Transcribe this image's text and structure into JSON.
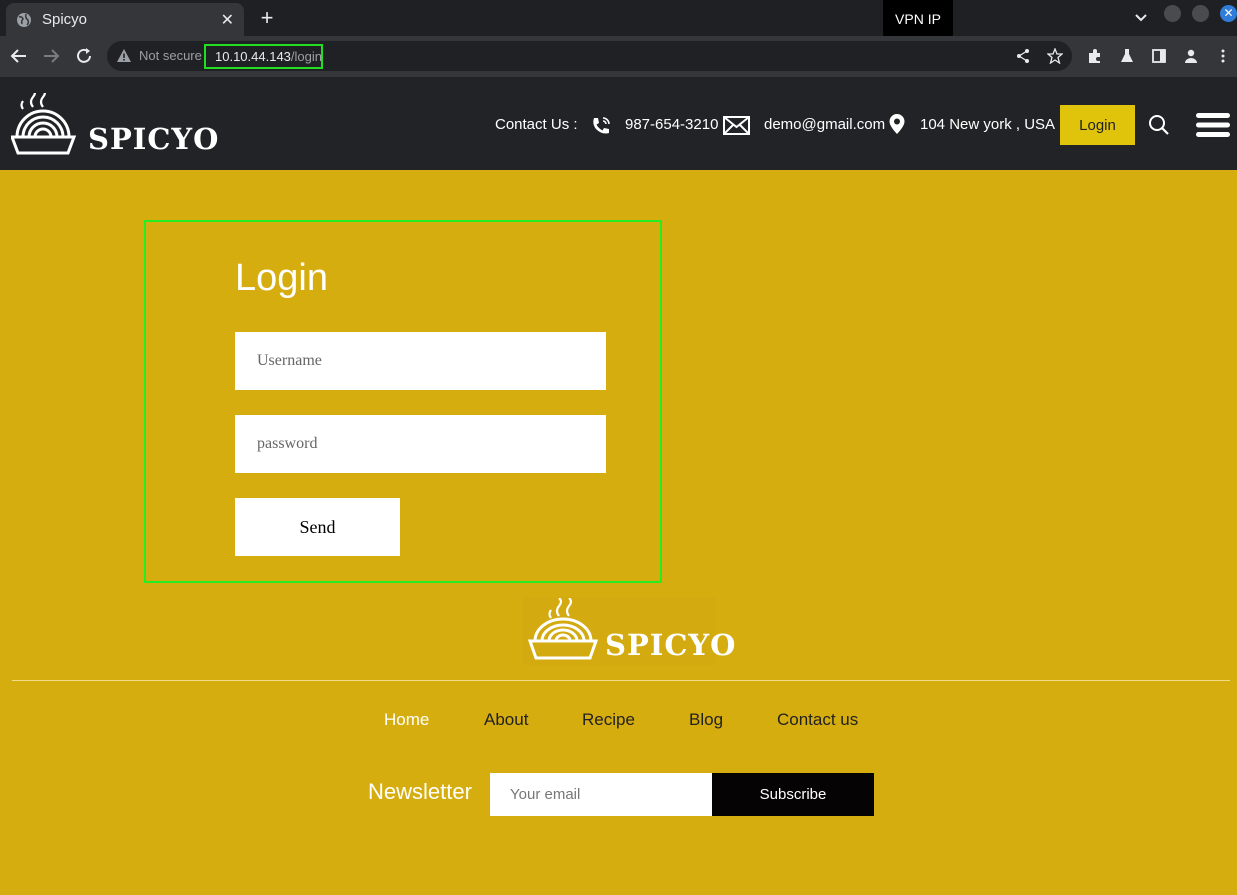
{
  "browser": {
    "tab_title": "Spicyo",
    "tab_close": "✕",
    "new_tab": "+",
    "vpn_label": "VPN IP",
    "security_label": "Not secure",
    "url_host": "10.10.44.143",
    "url_path": "/login",
    "close_glyph": "✕"
  },
  "header": {
    "brand": "SPICYO",
    "contact_label": "Contact Us :",
    "phone": "987-654-3210",
    "email": "demo@gmail.com",
    "address": "104 New york , USA",
    "login_label": "Login"
  },
  "login": {
    "title": "Login",
    "username_placeholder": "Username",
    "password_placeholder": "password",
    "send_label": "Send"
  },
  "footer": {
    "brand": "SPICYO",
    "nav": [
      "Home",
      "About",
      "Recipe",
      "Blog",
      "Contact us"
    ],
    "newsletter_label": "Newsletter",
    "email_placeholder": "Your email",
    "subscribe_label": "Subscribe"
  },
  "colors": {
    "page_bg": "#d6ad0f",
    "header_bg": "#222326",
    "login_button": "#e0c40c",
    "highlight_border": "#22ee22"
  }
}
